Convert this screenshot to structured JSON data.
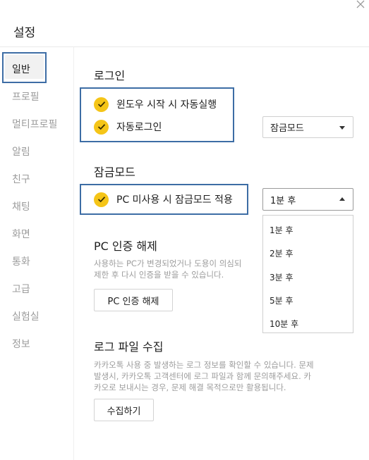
{
  "window": {
    "title": "설정",
    "close_icon": "close-icon"
  },
  "sidebar": {
    "items": [
      {
        "label": "일반",
        "selected": true
      },
      {
        "label": "프로필"
      },
      {
        "label": "멀티프로필"
      },
      {
        "label": "알림"
      },
      {
        "label": "친구"
      },
      {
        "label": "채팅"
      },
      {
        "label": "화면"
      },
      {
        "label": "통화"
      },
      {
        "label": "고급"
      },
      {
        "label": "실험실"
      },
      {
        "label": "정보"
      }
    ]
  },
  "login": {
    "title": "로그인",
    "auto_start_label": "윈도우 시작 시 자동실행",
    "auto_login_label": "자동로그인",
    "auto_login_select": "잠금모드"
  },
  "lock_mode": {
    "title": "잠금모드",
    "idle_lock_label": "PC 미사용 시 잠금모드 적용",
    "idle_select": "1분 후",
    "options": [
      "1분 후",
      "2분 후",
      "3분 후",
      "5분 후",
      "10분 후"
    ]
  },
  "pc_auth": {
    "title": "PC 인증 해제",
    "desc_line1": "사용하는 PC가 변경되었거나 도용이 의심되",
    "desc_line2": "제한 후 다시 인증을 받을 수 있습니다.",
    "button": "PC 인증 해제"
  },
  "log_collect": {
    "title": "로그 파일 수집",
    "desc_line1": "카카오톡 사용 중 발생하는 로그 정보를 확인할 수 있습니다. 문제",
    "desc_line2": "발생시, 카카오톡 고객센터에 로그 파일과 함께 문의해주세요. 카",
    "desc_line3": "카오로 보내시는 경우, 문제 해결 목적으로만 활용됩니다.",
    "button": "수집하기"
  },
  "colors": {
    "accent": "#f5c518",
    "highlight": "#3d6da5"
  }
}
